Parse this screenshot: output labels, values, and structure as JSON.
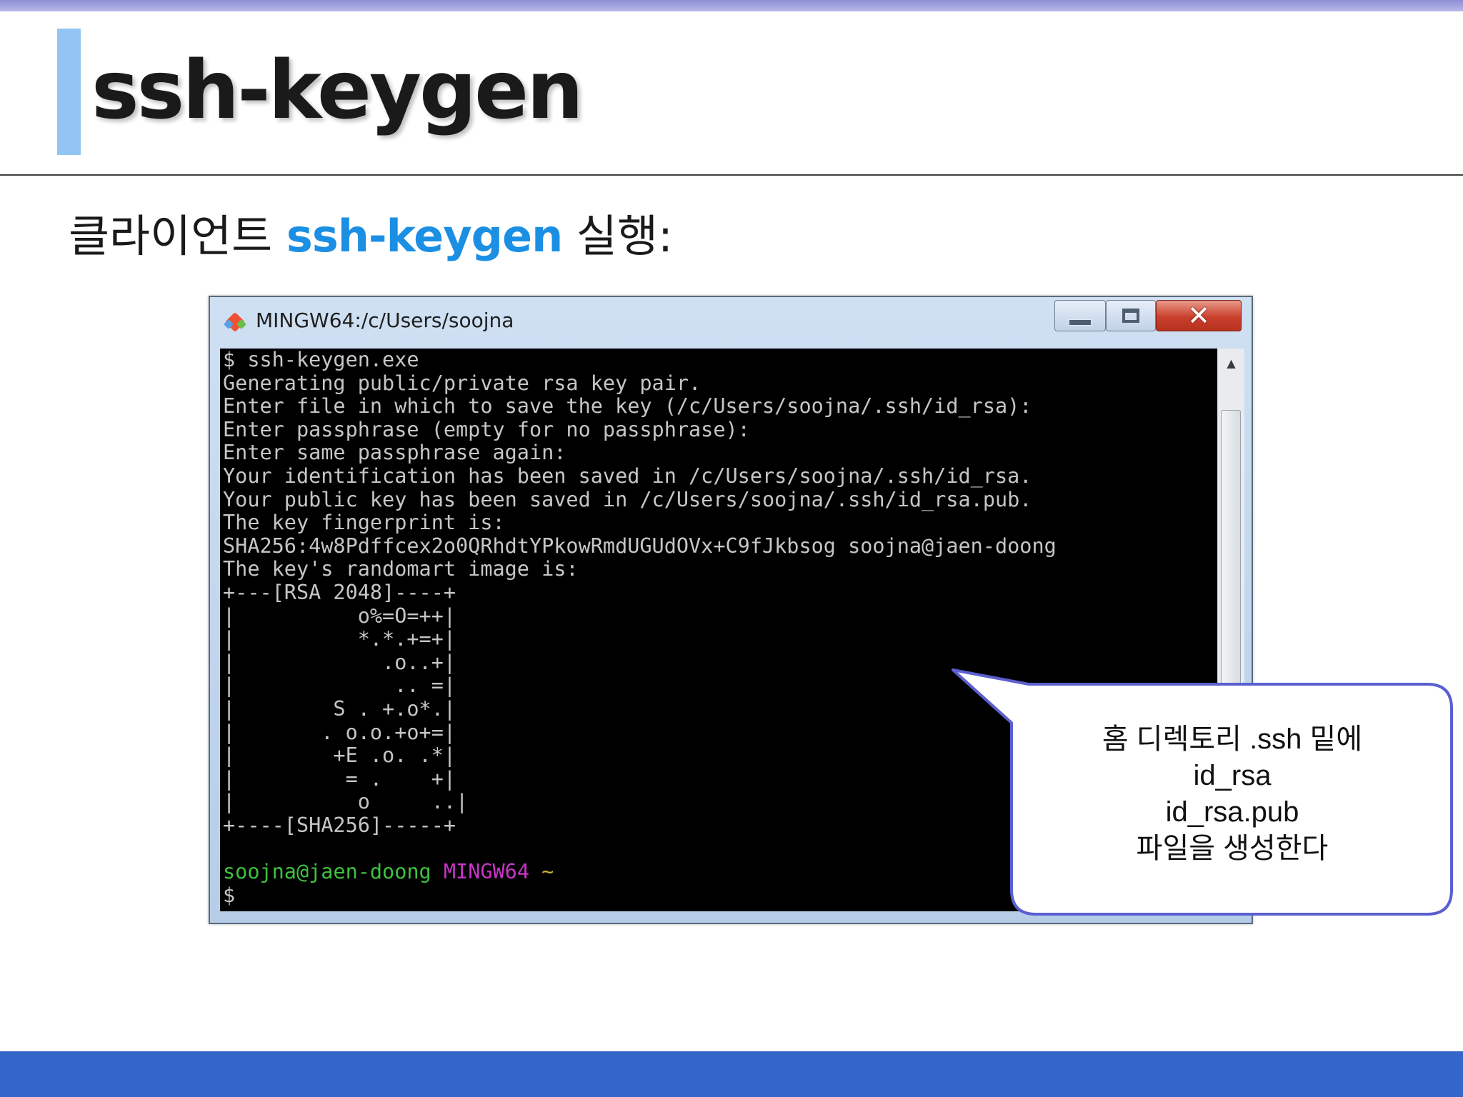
{
  "slide": {
    "title": "ssh-keygen",
    "subtitle_prefix": "클라이언트",
    "subtitle_highlight": "ssh-keygen",
    "subtitle_suffix": "실행:"
  },
  "window": {
    "title": "MINGW64:/c/Users/soojna",
    "minimize_icon": "minimize-icon",
    "maximize_icon": "maximize-icon",
    "close_icon": "close-icon",
    "app_icon": "git-icon",
    "scroll_up_icon": "chevron-up-icon"
  },
  "terminal": {
    "lines": [
      "$ ssh-keygen.exe",
      "Generating public/private rsa key pair.",
      "Enter file in which to save the key (/c/Users/soojna/.ssh/id_rsa):",
      "Enter passphrase (empty for no passphrase):",
      "Enter same passphrase again:",
      "Your identification has been saved in /c/Users/soojna/.ssh/id_rsa.",
      "Your public key has been saved in /c/Users/soojna/.ssh/id_rsa.pub.",
      "The key fingerprint is:",
      "SHA256:4w8Pdffcex2o0QRhdtYPkowRmdUGUdOVx+C9fJkbsog soojna@jaen-doong",
      "The key's randomart image is:",
      "+---[RSA 2048]----+",
      "|          o%=O=++|",
      "|          *.*.+=+|",
      "|            .o..+|",
      "|             .. =|",
      "|        S . +.o*.|",
      "|       . o.o.+o+=|",
      "|        +E .o. .*|",
      "|         = .    +|",
      "|          o     ..|",
      "+----[SHA256]-----+",
      ""
    ],
    "prompt_user": "soojna@jaen-doong",
    "prompt_shell": "MINGW64",
    "prompt_path": "~",
    "prompt_symbol": "$"
  },
  "callout": {
    "lines": [
      "홈 디렉토리 .ssh 밑에",
      "id_rsa",
      "id_rsa.pub",
      "파일을 생성한다"
    ]
  }
}
